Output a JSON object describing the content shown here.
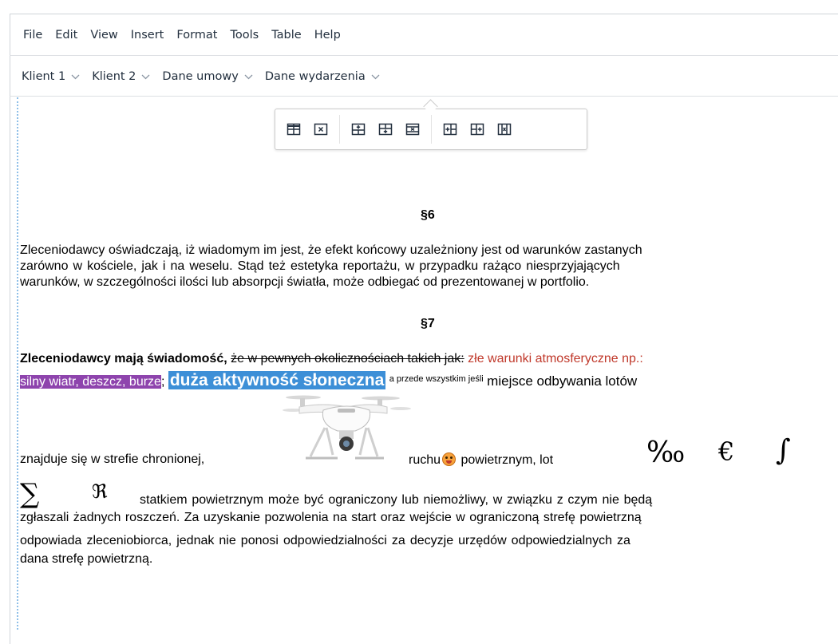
{
  "menubar": [
    "File",
    "Edit",
    "View",
    "Insert",
    "Format",
    "Tools",
    "Table",
    "Help"
  ],
  "toolbar": [
    "Klient 1",
    "Klient 2",
    "Dane umowy",
    "Dane wydarzenia"
  ],
  "table_toolbar": {
    "groups": [
      [
        "table-properties-icon",
        "delete-table-icon"
      ],
      [
        "insert-row-before-icon",
        "insert-row-after-icon",
        "delete-row-icon"
      ],
      [
        "insert-column-before-icon",
        "insert-column-after-icon",
        "delete-column-icon"
      ]
    ]
  },
  "doc": {
    "sec6": "§6",
    "p6_l1": "Zleceniodawcy oświadczają, iż wiadomym im jest, że efekt końcowy uzależniony jest od warunków zastanych",
    "p6_l2": "zarówno w kościele, jak i na weselu. Stąd też estetyka reportażu, w przypadku rażąco niesprzyjających",
    "p6_l3": "warunków, w szczególności ilości lub absorpcji światła, może odbiegać od prezentowanej w portfolio.",
    "sec7": "§7",
    "p7_bold": "Zleceniodawcy mają świadomość,",
    "p7_strike": "że w pewnych okolicznościach takich jak:",
    "p7_red": "złe warunki atmosferyczne np.:",
    "p7_purple": "silny wiatr, deszcz, burze",
    "p7_semicolon": ";",
    "p7_blue": "duża aktywność słoneczna",
    "p7_tiny": "a przede wszystkim jeśli",
    "p7_rest": "miejsce odbywania lotów",
    "line3_a": "znajduje się w strefie chronionej,",
    "line3_b": "ruchu",
    "line3_c": "powietrznym, lot",
    "sym_permille": "‰",
    "sym_euro": "€",
    "sym_integral": "∫",
    "sym_sigma": "∑",
    "sym_fraktur": "ℜ",
    "line4": "statkiem powietrznym może być ograniczony lub niemożliwy, w związku z czym nie będą",
    "line5": "zgłaszali żadnych roszczeń. Za uzyskanie pozwolenia na start oraz wejście w ograniczoną strefę powietrzną",
    "line6": "odpowiada zleceniobiorca, jednak nie ponosi odpowiedzialności za decyzje urzędów odpowiedzialnych za",
    "line7": "dana strefę powietrzną."
  },
  "colors": {
    "strike_text": "#000000",
    "red_text": "#c0392b",
    "purple_highlight": "#8e44ad",
    "blue_highlight": "#3d8fd7"
  }
}
